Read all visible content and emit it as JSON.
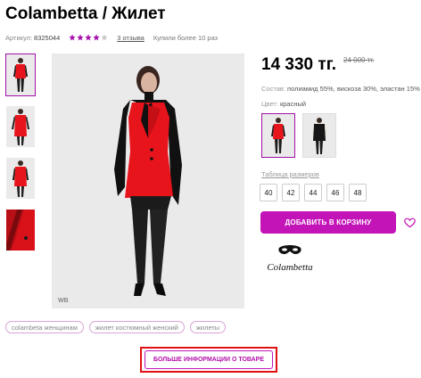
{
  "product": {
    "title": "Colambetta / Жилет",
    "article_label": "Артикул:",
    "article_value": "8325044",
    "rating": 4,
    "rating_max": 5,
    "reviews_text": "3 отзыва",
    "bought_text": "Купили более 10 раз",
    "price": "14 330 тг.",
    "old_price": "24 000 тг.",
    "composition_label": "Состав:",
    "composition_value": "полиамид 55%, вискоза 30%, эластан 15%",
    "color_label": "Цвет:",
    "color_value": "красный",
    "size_table_label": "Таблица размеров",
    "sizes": [
      "40",
      "42",
      "44",
      "46",
      "48"
    ],
    "add_to_cart_label": "ДОБАВИТЬ В КОРЗИНУ",
    "brand_logo_text": "Colambetta",
    "photo_watermark": "WB"
  },
  "tags": [
    "colambeta женщинам",
    "жилет костюмный женский",
    "жилеты"
  ],
  "more_info_label": "БОЛЬШЕ ИНФОРМАЦИИ О ТОВАРЕ",
  "colors": {
    "accent": "#c314b8",
    "highlight_frame": "#e21111",
    "product_red": "#e8141c",
    "star_filled": "#a40fa8",
    "star_empty": "#c9c9c9"
  },
  "icons": {
    "favorite": "heart-outline-icon",
    "rating": "star-icon"
  }
}
